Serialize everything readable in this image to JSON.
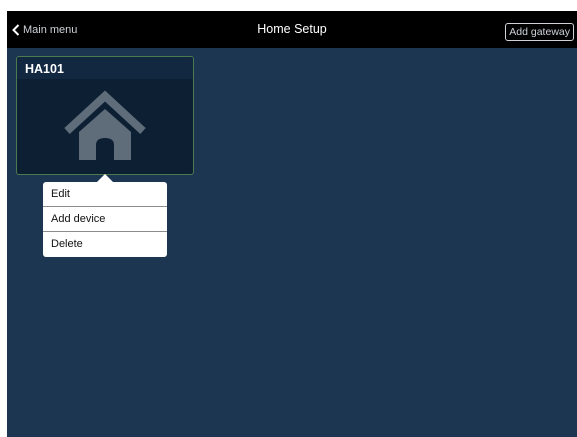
{
  "navbar": {
    "back_label": "Main menu",
    "title": "Home Setup",
    "add_gateway_label": "Add gateway"
  },
  "gateway_card": {
    "name": "HA101",
    "icon": "house-icon"
  },
  "context_menu": {
    "items": [
      {
        "label": "Edit"
      },
      {
        "label": "Add device"
      },
      {
        "label": "Delete"
      }
    ]
  },
  "colors": {
    "background": "#1c3651",
    "navbar": "#000000",
    "card_background": "#0d2033",
    "card_border": "#4b7a4f",
    "icon": "#5f6d7a"
  }
}
